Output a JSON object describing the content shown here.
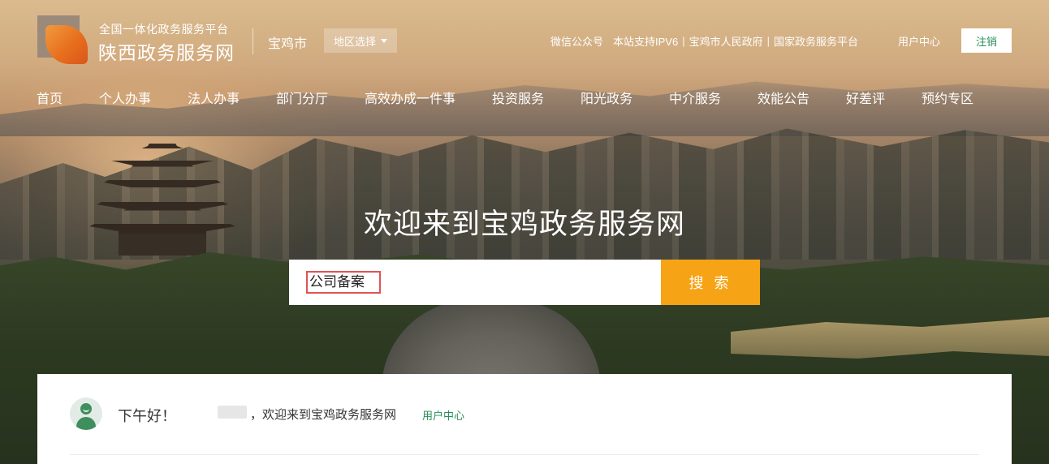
{
  "header": {
    "site_subtitle": "全国一体化政务服务平台",
    "site_name": "陕西政务服务网",
    "city": "宝鸡市",
    "region_select": "地区选择",
    "links": [
      "微信公众号",
      "本站支持IPV6",
      "宝鸡市人民政府",
      "国家政务服务平台"
    ],
    "user_center": "用户中心",
    "logout": "注销"
  },
  "nav": {
    "items": [
      "首页",
      "个人办事",
      "法人办事",
      "部门分厅",
      "高效办成一件事",
      "投资服务",
      "阳光政务",
      "中介服务",
      "效能公告",
      "好差评",
      "预约专区"
    ]
  },
  "hero": {
    "welcome": "欢迎来到宝鸡政务服务网"
  },
  "search": {
    "value": "公司备案",
    "button": "搜 索"
  },
  "panel": {
    "greeting": "下午好！",
    "welcome_text": "，欢迎来到宝鸡政务服务网",
    "user_center": "用户中心"
  },
  "colors": {
    "accent_orange": "#f7a316",
    "brand_green": "#2a8e5a",
    "highlight_red": "#e05353"
  }
}
